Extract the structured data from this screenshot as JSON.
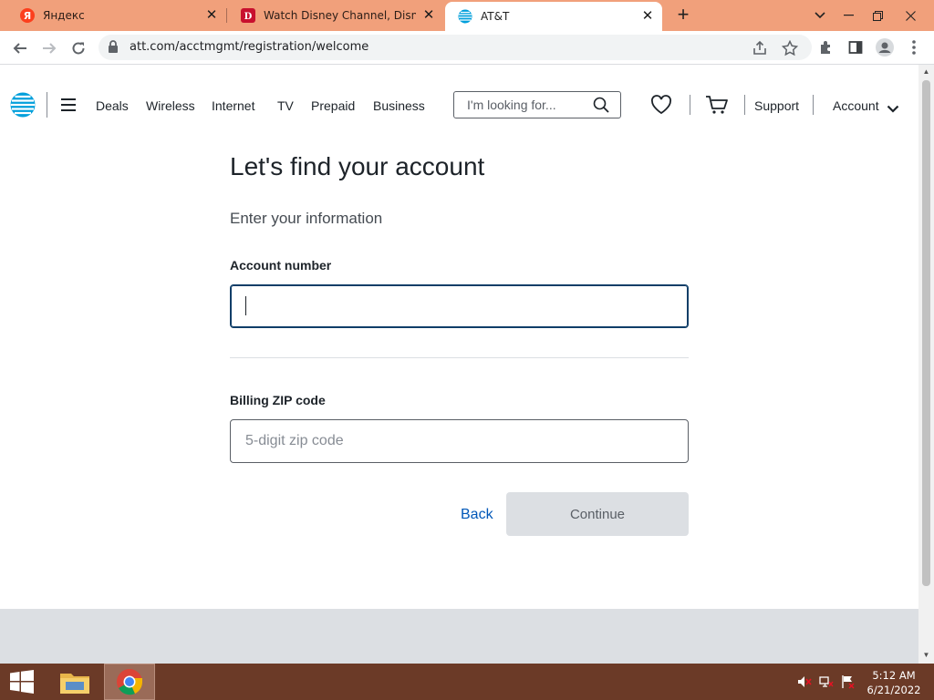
{
  "browser": {
    "tabs": [
      {
        "title": "Яндекс",
        "favicon": "yandex-icon"
      },
      {
        "title": "Watch Disney Channel, Disney Ju",
        "favicon": "disney-icon"
      },
      {
        "title": "AT&T",
        "favicon": "att-globe-icon",
        "active": true
      }
    ],
    "url": "att.com/acctmgmt/registration/welcome"
  },
  "header": {
    "nav": [
      "Deals",
      "Wireless",
      "Internet",
      "TV",
      "Prepaid",
      "Business"
    ],
    "search_placeholder": "I'm looking for...",
    "support": "Support",
    "account": "Account"
  },
  "form": {
    "title": "Let's find your account",
    "subtitle": "Enter your information",
    "account_number_label": "Account number",
    "account_number_value": "",
    "zip_label": "Billing ZIP code",
    "zip_placeholder": "5-digit zip code",
    "zip_value": "",
    "back_label": "Back",
    "continue_label": "Continue"
  },
  "taskbar": {
    "time": "5:12 AM",
    "date": "6/21/2022"
  },
  "colors": {
    "tabstrip": "#f1a07b",
    "att_blue": "#009fdb",
    "link_blue": "#0057b8",
    "taskbar": "#6b3a27"
  }
}
